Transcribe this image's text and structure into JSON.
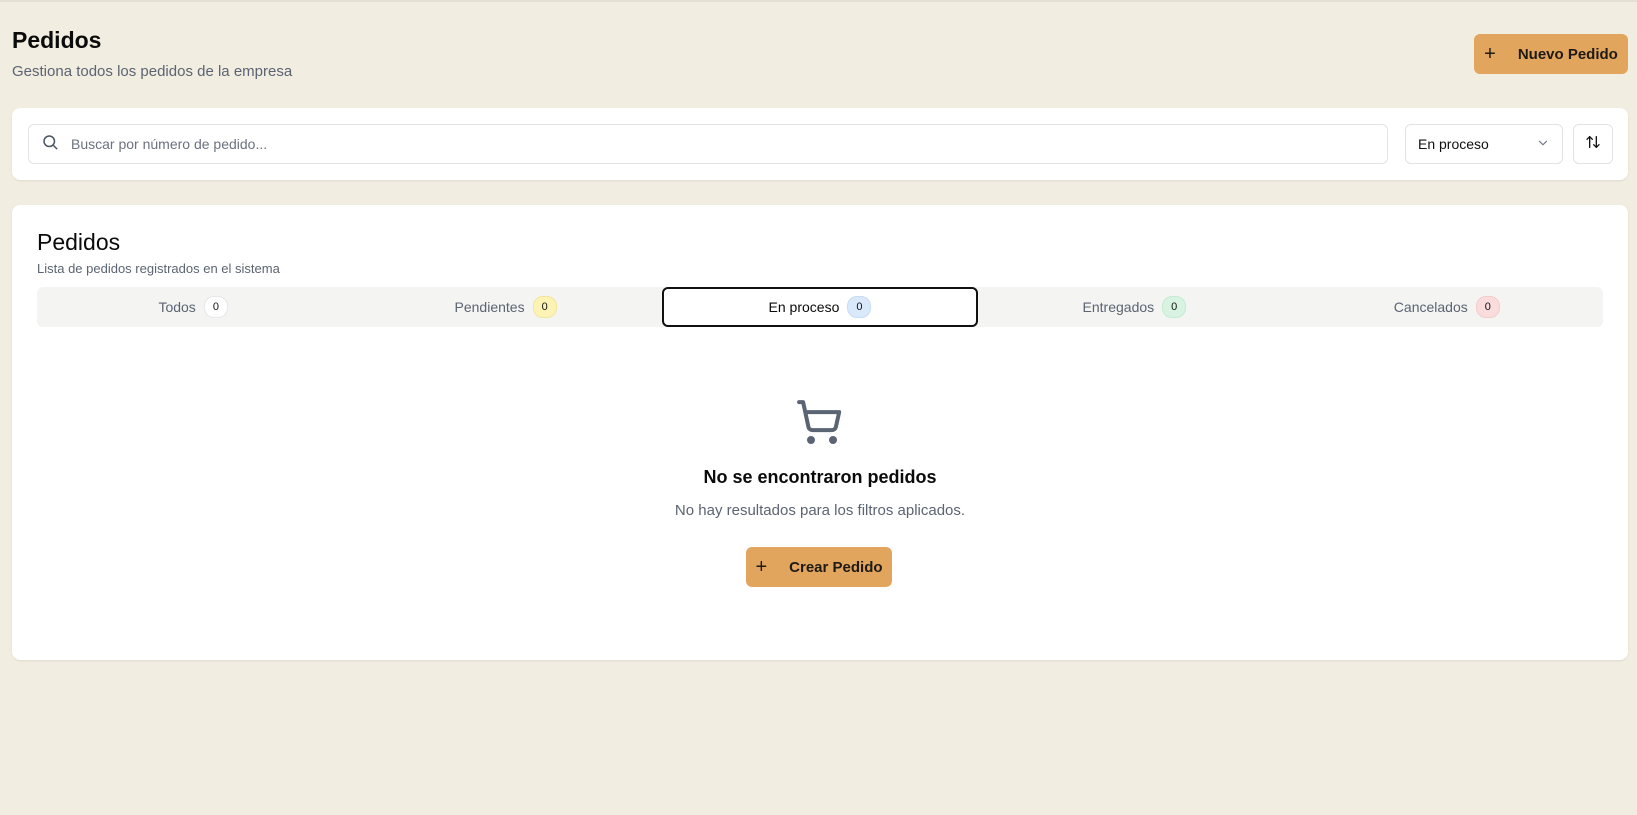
{
  "header": {
    "title": "Pedidos",
    "subtitle": "Gestiona todos los pedidos de la empresa",
    "new_order_label": "Nuevo Pedido"
  },
  "filters": {
    "search_placeholder": "Buscar por número de pedido...",
    "status_selected": "En proceso"
  },
  "orders": {
    "title": "Pedidos",
    "description": "Lista de pedidos registrados en el sistema",
    "tabs": [
      {
        "label": "Todos",
        "count": "0",
        "color": "gray"
      },
      {
        "label": "Pendientes",
        "count": "0",
        "color": "yellow"
      },
      {
        "label": "En proceso",
        "count": "0",
        "color": "blue",
        "active": true
      },
      {
        "label": "Entregados",
        "count": "0",
        "color": "green"
      },
      {
        "label": "Cancelados",
        "count": "0",
        "color": "red"
      }
    ],
    "empty": {
      "icon": "shopping-cart-icon",
      "title": "No se encontraron pedidos",
      "description": "No hay resultados para los filtros aplicados.",
      "button_label": "Crear Pedido"
    }
  },
  "colors": {
    "background": "#f2ede1",
    "accent": "#e2a55e"
  }
}
